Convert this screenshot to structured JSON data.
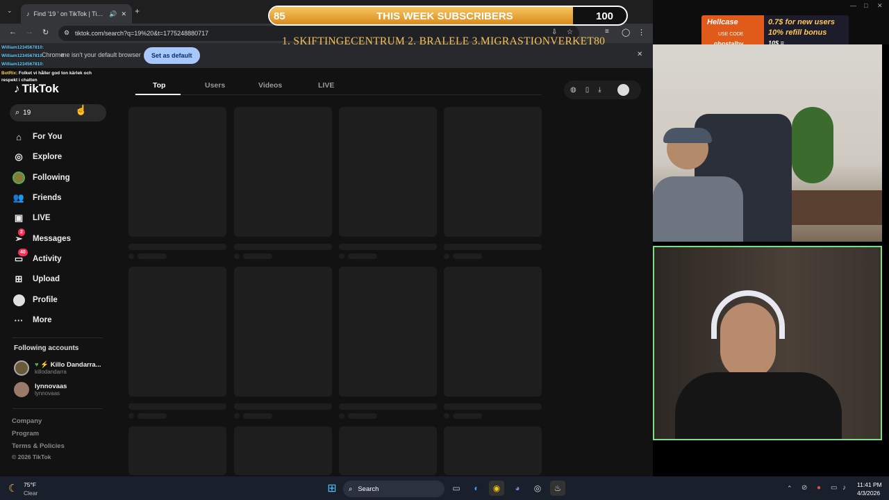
{
  "browser": {
    "tab_title": "Find '19 ' on TikTok | TikTok",
    "url": "tiktok.com/search?q=19%20&t=1775248880717",
    "infobar_text": "me isn't your default browser",
    "infobar_prefix": "Chrome",
    "set_default_label": "Set as default"
  },
  "tiktok": {
    "logo": "TikTok",
    "search_value": "19",
    "nav": [
      {
        "label": "For You",
        "icon": "home-icon"
      },
      {
        "label": "Explore",
        "icon": "compass-icon"
      },
      {
        "label": "Following",
        "icon": "avatar-icon"
      },
      {
        "label": "Friends",
        "icon": "friends-icon"
      },
      {
        "label": "LIVE",
        "icon": "live-icon"
      },
      {
        "label": "Messages",
        "icon": "send-icon",
        "badge": "2"
      },
      {
        "label": "Activity",
        "icon": "inbox-icon",
        "badge": "40"
      },
      {
        "label": "Upload",
        "icon": "plus-icon"
      },
      {
        "label": "Profile",
        "icon": "profile-icon"
      },
      {
        "label": "More",
        "icon": "more-icon"
      }
    ],
    "following_header": "Following accounts",
    "accounts": [
      {
        "name": "Killo Dandarra...",
        "handle": "killodandarra"
      },
      {
        "name": "lynnovaas",
        "handle": "lynnovaas"
      }
    ],
    "footer": [
      "Company",
      "Program",
      "Terms & Policies",
      "© 2026 TikTok"
    ],
    "tabs": [
      "Top",
      "Users",
      "Videos",
      "LIVE"
    ],
    "active_tab": "Top"
  },
  "overlay": {
    "sub_current": "85",
    "sub_title": "THIS WEEK SUBSCRIBERS",
    "sub_goal": "100",
    "sub_progress": 0.85,
    "winners": "1. SKIFTINGECENTRUM  2. BRALELE 3.MIGRASTIONVERKET80",
    "chat": [
      {
        "user": "William1234567810",
        "msg": ":"
      },
      {
        "user": "William1234567810",
        "msg": ":"
      },
      {
        "user": "William1234567810",
        "msg": ":"
      },
      {
        "user": "BotRix",
        "msg": ": Folket vi håller god ton kärlek och respekt i chatten"
      }
    ],
    "hellcase": {
      "brand": "Hellcase",
      "code_label": "USE CODE",
      "code": "ghostalby",
      "line1": "0.7$ for new users",
      "line2": "10% refill bonus",
      "line3": "10$ ="
    }
  },
  "taskbar": {
    "temp": "75°F",
    "weather": "Clear",
    "search_label": "Search",
    "time": "11:41 PM",
    "date": "4/3/2026"
  },
  "colors": {
    "tiktok_red": "#fe2c55",
    "overlay_gold": "#f6c25a",
    "set_default_bg": "#a8c7fa"
  }
}
